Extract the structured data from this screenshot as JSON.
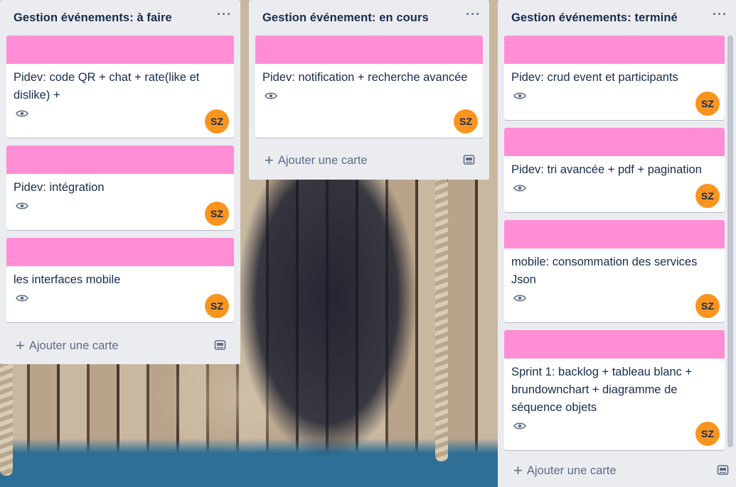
{
  "colors": {
    "list_bg": "#ebecf0",
    "card_cover": "#ff8ed4",
    "avatar_bg": "#f9941f",
    "text": "#172b4d",
    "muted": "#5e6c84"
  },
  "common": {
    "add_card_label": "Ajouter une carte",
    "menu_label": "···"
  },
  "lists": [
    {
      "title": "Gestion événements: à faire",
      "cards": [
        {
          "title": "Pidev: code QR + chat + rate(like et dislike) +",
          "member": "SZ",
          "watch_icon": "eye-icon"
        },
        {
          "title": "Pidev: intégration",
          "member": "SZ",
          "watch_icon": "eye-icon"
        },
        {
          "title": "les interfaces mobile",
          "member": "SZ",
          "watch_icon": "eye-icon"
        }
      ]
    },
    {
      "title": "Gestion événement: en cours",
      "cards": [
        {
          "title": "Pidev: notification + recherche avancée",
          "member": "SZ",
          "watch_icon": "eye-icon"
        }
      ]
    },
    {
      "title": "Gestion événements: terminé",
      "cards": [
        {
          "title": "Pidev: crud event et participants",
          "member": "SZ",
          "watch_icon": "eye-icon"
        },
        {
          "title": "Pidev: tri avancée + pdf + pagination",
          "member": "SZ",
          "watch_icon": "eye-icon"
        },
        {
          "title": "mobile: consommation des services Json",
          "member": "SZ",
          "watch_icon": "eye-icon"
        },
        {
          "title": "Sprint 1: backlog + tableau blanc + brundownchart + diagramme de séquence objets",
          "member": "SZ",
          "watch_icon": "eye-icon"
        }
      ]
    }
  ]
}
